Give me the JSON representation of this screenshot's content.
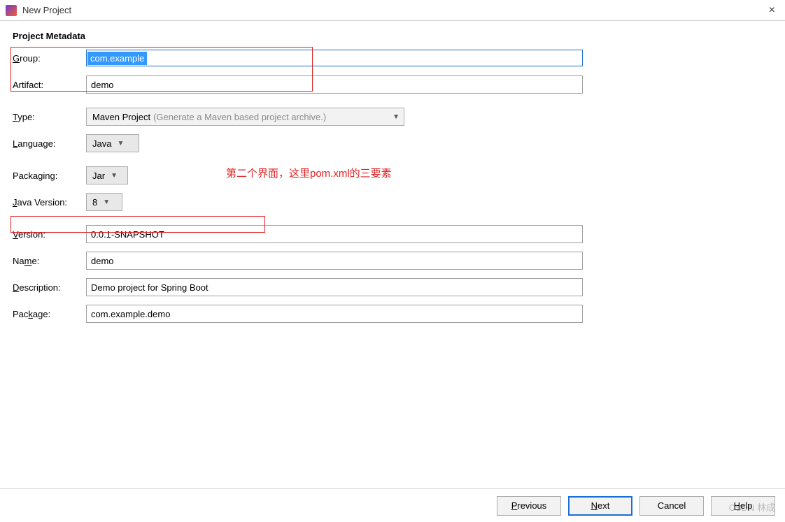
{
  "window": {
    "title": "New Project",
    "close": "×"
  },
  "section_header": "Project Metadata",
  "labels": {
    "group": "Group:",
    "artifact": "Artifact:",
    "type": "Type:",
    "language": "Language:",
    "packaging": "Packaging:",
    "java_version": "Java Version:",
    "version": "Version:",
    "name": "Name:",
    "description": "Description:",
    "package": "Package:"
  },
  "values": {
    "group": "com.example",
    "artifact": "demo",
    "type": "Maven Project",
    "type_hint": "(Generate a Maven based project archive.)",
    "language": "Java",
    "packaging": "Jar",
    "java_version": "8",
    "version": "0.0.1-SNAPSHOT",
    "name": "demo",
    "description": "Demo project for Spring Boot",
    "package": "com.example.demo"
  },
  "annotation": "第二个界面，这里pom.xml的三要素",
  "footer": {
    "previous": "Previous",
    "next": "Next",
    "cancel": "Cancel",
    "help": "Help"
  },
  "watermark": "CSDN 林成",
  "underline": {
    "group": "G",
    "type": "T",
    "language": "L",
    "java_version": "J",
    "version": "V",
    "name_m": "m",
    "description": "D",
    "package_k": "k",
    "previous": "P",
    "next": "N",
    "help": "H"
  }
}
